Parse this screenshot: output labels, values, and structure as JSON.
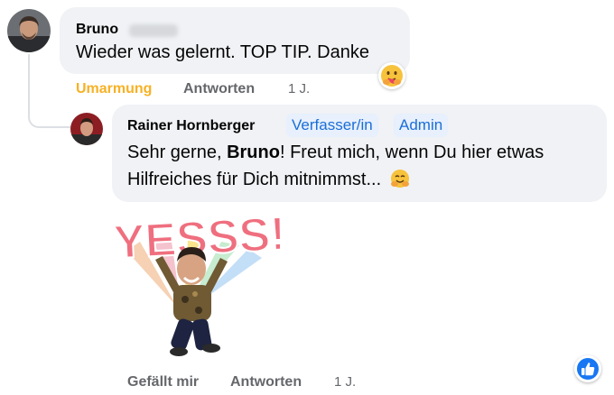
{
  "comment": {
    "author_first": "Bruno",
    "text": "Wieder was gelernt. TOP TIP. Danke",
    "reaction_icon": "hug-emoji-icon",
    "actions": {
      "reaction_label": "Umarmung",
      "reply_label": "Antworten",
      "time": "1 J."
    }
  },
  "reply": {
    "author": "Rainer Hornberger",
    "badges": [
      "Verfasser/in",
      "Admin"
    ],
    "text_before": "Sehr gerne, ",
    "text_mention": "Bruno",
    "text_after": "! Freut mich, wenn Du hier etwas",
    "text_line2": "Hilfreiches für Dich mitnimmst...",
    "sticker_text": "YESSS!",
    "actions": {
      "like_label": "Gefällt mir",
      "reply_label": "Antworten",
      "time": "1 J."
    }
  },
  "colors": {
    "bubble_bg": "#f0f2f5",
    "accent_blue": "#1a6ed8",
    "reaction_yellow": "#f7b125",
    "muted": "#65676b"
  }
}
